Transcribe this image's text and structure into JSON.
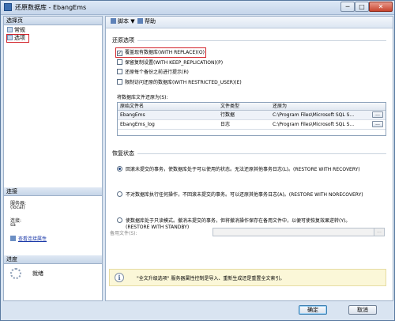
{
  "window": {
    "title": "还原数据库 - EbangEms",
    "minimize": "─",
    "maximize": "□",
    "close": "✕"
  },
  "left_panel": {
    "select_page_header": "选择页",
    "pages": [
      {
        "label": "常规"
      },
      {
        "label": "选项"
      }
    ],
    "connection_header": "连接",
    "server_label": "服务器:",
    "server_value": "(local)",
    "conn_label": "连接:",
    "conn_value": "sa",
    "view_props_link": "查看连接属性",
    "progress_header": "进度",
    "progress_status": "就绪"
  },
  "toolbar": {
    "script_label": "脚本",
    "script_arrow": "▼",
    "help_label": "帮助"
  },
  "restore_options": {
    "heading": "还原选项",
    "checks": [
      {
        "label": "覆盖现有数据库(WITH REPLACE)(O)",
        "checked": true
      },
      {
        "label": "保留复制设置(WITH KEEP_REPLICATION)(P)",
        "checked": false
      },
      {
        "label": "还原每个备份之前进行提示(R)",
        "checked": false
      },
      {
        "label": "限制访问还原的数据库(WITH RESTRICTED_USER)(E)",
        "checked": false
      }
    ],
    "files_label": "将数据库文件还原为(S):",
    "columns": [
      "原始文件名",
      "文件类型",
      "还原为"
    ],
    "rows": [
      {
        "name": "EbangEms",
        "type": "行数据",
        "path": "C:\\Program Files\\Microsoft SQL S...",
        "btn": "..."
      },
      {
        "name": "EbangEms_log",
        "type": "日志",
        "path": "C:\\Program Files\\Microsoft SQL S...",
        "btn": "..."
      }
    ]
  },
  "recovery": {
    "heading": "恢复状态",
    "options": [
      {
        "label": "回滚未提交的事务，使数据库处于可以使用的状态。无法还原其他事务日志(L)。(RESTORE WITH RECOVERY)",
        "checked": true
      },
      {
        "label": "不对数据库执行任何操作，不回滚未提交的事务。可以还原其他事务日志(A)。(RESTORE WITH NORECOVERY)",
        "checked": false
      },
      {
        "label": "使数据库处于只读模式。撤消未提交的事务，但将撤消操作保存在备用文件中，以便可使恢复效果逆转(Y)。",
        "label2": "(RESTORE WITH STANDBY)",
        "checked": false
      }
    ],
    "standby_label": "备用文件(S):",
    "standby_value": "",
    "standby_btn": "..."
  },
  "info": {
    "icon": "i",
    "text": "\"全文升级选项\" 服务器属性控制是导入、重新生成还是重置全文索引。"
  },
  "buttons": {
    "ok": "确定",
    "cancel": "取消"
  },
  "colors": {
    "highlight": "#d2232a",
    "link": "#1c3aa9",
    "info_bg": "#fbf7d8"
  }
}
